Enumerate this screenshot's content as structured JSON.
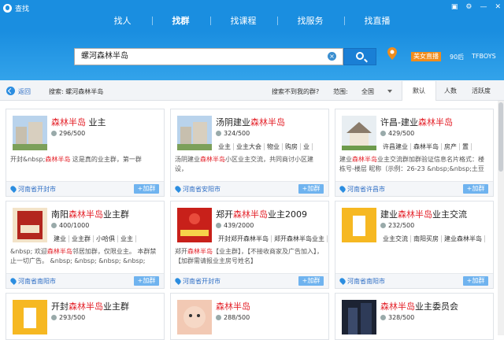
{
  "window": {
    "title": "查找",
    "controls": [
      "▣",
      "⚙",
      "—",
      "✕"
    ]
  },
  "nav": {
    "tabs": [
      "找人",
      "找群",
      "找课程",
      "找服务",
      "找直播"
    ],
    "active": 1
  },
  "search": {
    "value": "螺河森林半岛",
    "clear_label": "×"
  },
  "promo": {
    "badge": "美女直播",
    "age": "90后",
    "user": "TFBOYS"
  },
  "filter": {
    "back": "返回",
    "crumb": "搜索: 螺河森林半岛",
    "notfound": "搜索不到我的群?",
    "range_label": "范围:",
    "range_value": "全国",
    "sort": [
      "默认",
      "人数",
      "活跃度"
    ]
  },
  "colors": {
    "accent": "#1a8ee0",
    "highlight": "#e4242c",
    "join": "#6fb3ef"
  },
  "cards": [
    {
      "name_pre": "",
      "name_hl": "森林半岛",
      "name_post": " 业主",
      "count": "296/500",
      "tags": [],
      "desc_pre": "开封&nbsp;",
      "desc_hl": "森林半岛",
      "desc_post": " 这是真的业主群，第一群",
      "location": "河南省开封市",
      "join": "+加群"
    },
    {
      "name_pre": "汤阴建业",
      "name_hl": "森林半岛",
      "name_post": "",
      "count": "324/500",
      "tags": [
        "业主",
        "业主大会",
        "物业",
        "购房",
        "业"
      ],
      "desc_pre": "汤阴建业",
      "desc_hl": "森林半岛",
      "desc_post": "小区业主交流，共同商讨小区建设，",
      "location": "河南省安阳市",
      "join": "+加群"
    },
    {
      "name_pre": "许昌-建业",
      "name_hl": "森林半岛",
      "name_post": "",
      "count": "429/500",
      "tags": [
        "许昌建业",
        "森林半岛",
        "房产",
        "置"
      ],
      "desc_pre": "建业",
      "desc_hl": "森林半岛",
      "desc_post": "业主交流群加群验证信息名片格式：楼栋号-楼层 昵称（示例：26-23 &nbsp;&nbsp;土豆",
      "location": "河南省许昌市",
      "join": "+加群"
    },
    {
      "name_pre": "南阳",
      "name_hl": "森林半岛",
      "name_post": "业主群",
      "count": "400/1000",
      "tags": [
        "建业",
        "业主群",
        "小哈俱",
        "业主"
      ],
      "desc_pre": "&nbsp; 欢迎",
      "desc_hl": "森林半岛",
      "desc_post": "邻居加群，仅限业主。 本群禁止一切广告。 &nbsp; &nbsp; &nbsp; &nbsp;",
      "location": "河南省南阳市",
      "join": "+加群"
    },
    {
      "name_pre": "郑开",
      "name_hl": "森林半岛",
      "name_post": "业主2009",
      "count": "439/2000",
      "tags": [
        "开封郑开森林半岛",
        "郑开森林半岛业主"
      ],
      "desc_pre": "郑开",
      "desc_hl": "森林半岛",
      "desc_post": "【业主群】，【不接收商家及广告加入】，【加群需请报业主房号姓名】",
      "location": "河南省开封市",
      "join": "+加群"
    },
    {
      "name_pre": "建业",
      "name_hl": "森林半岛",
      "name_post": "业主交流",
      "count": "232/500",
      "tags": [
        "业主交流",
        "南阳买房",
        "建业森林半岛"
      ],
      "desc_pre": "",
      "desc_hl": "",
      "desc_post": "",
      "location": "河南省南阳市",
      "join": "+加群"
    },
    {
      "name_pre": "开封",
      "name_hl": "森林半岛",
      "name_post": "业主群",
      "count": "293/500",
      "tags": [],
      "desc_pre": "",
      "desc_hl": "",
      "desc_post": "",
      "location": "",
      "join": ""
    },
    {
      "name_pre": "",
      "name_hl": "森林半岛",
      "name_post": "",
      "count": "288/500",
      "tags": [],
      "desc_pre": "",
      "desc_hl": "",
      "desc_post": "",
      "location": "",
      "join": ""
    },
    {
      "name_pre": "",
      "name_hl": "森林半岛",
      "name_post": "业主委员会",
      "count": "328/500",
      "tags": [],
      "desc_pre": "",
      "desc_hl": "",
      "desc_post": "",
      "location": "",
      "join": ""
    }
  ],
  "thumbs": [
    "building-photo",
    "building-photo",
    "house-photo",
    "red-book-cover",
    "red-poster",
    "placeholder-building-icon",
    "placeholder-building-icon",
    "baby-photo",
    "night-building-photo"
  ]
}
